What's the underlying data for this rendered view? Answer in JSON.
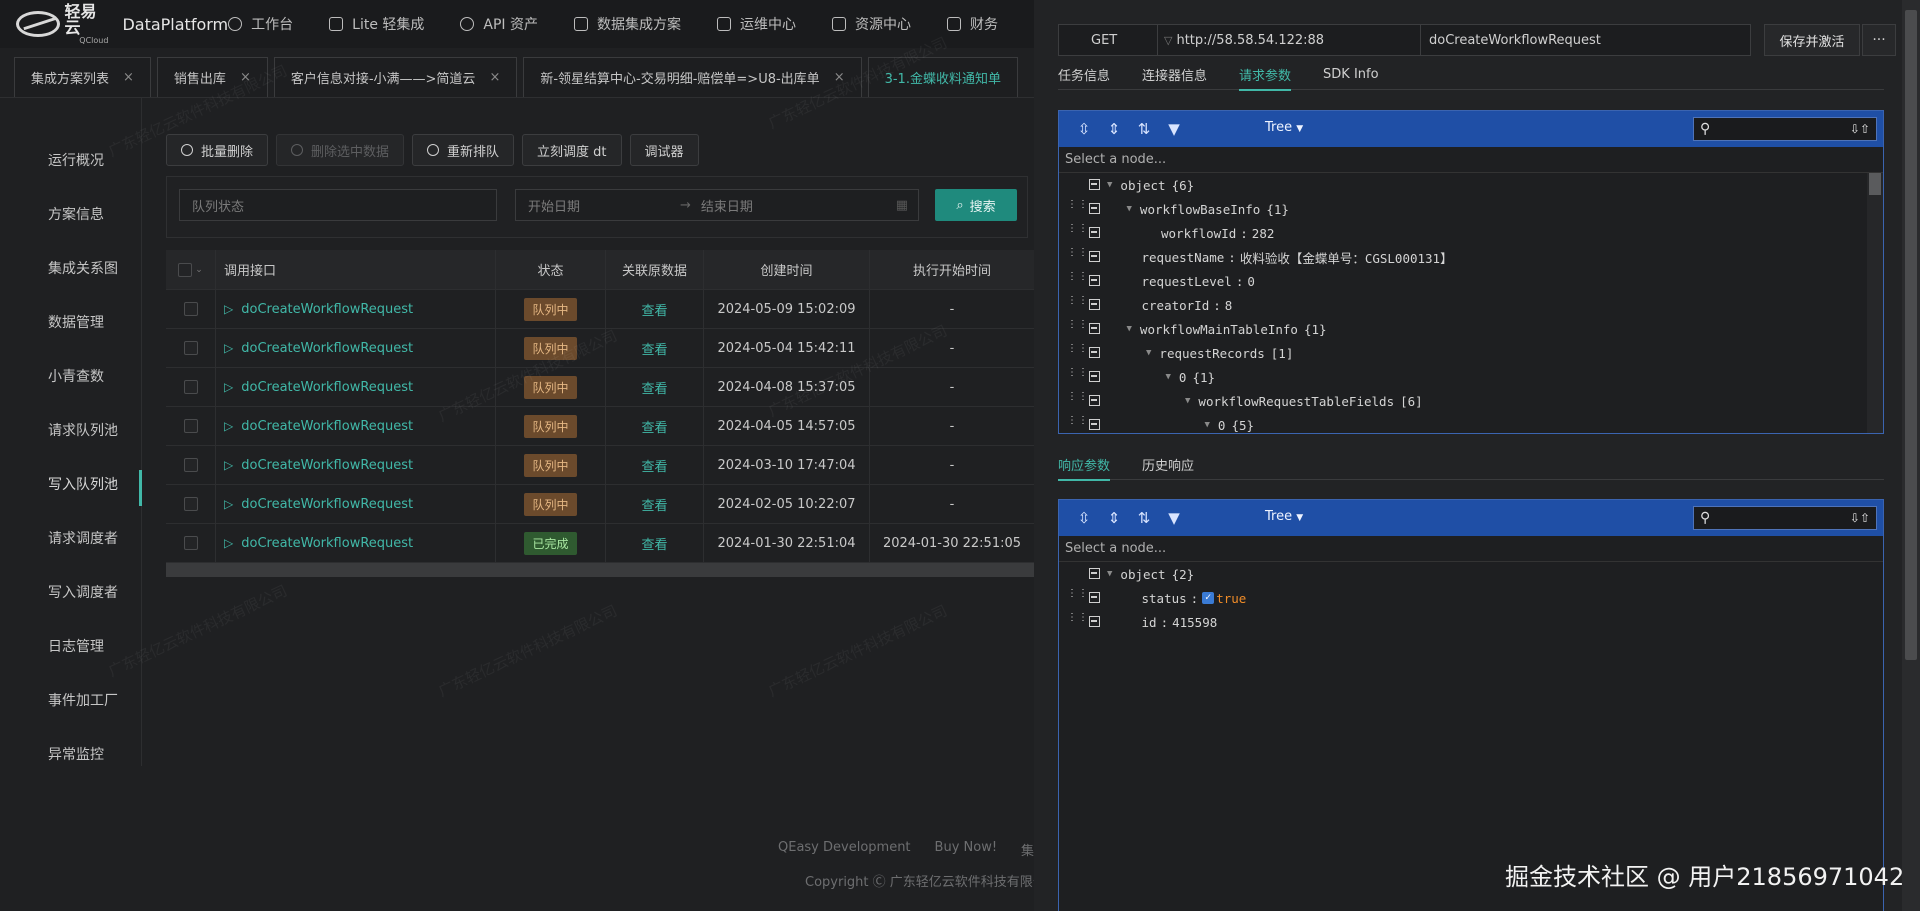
{
  "app": {
    "logo_cn": "轻易云",
    "logo_sub": "QCloud",
    "name": "DataPlatform"
  },
  "nav": [
    {
      "label": "工作台",
      "icon": "clock-icon"
    },
    {
      "label": "Lite 轻集成",
      "icon": "bell-icon"
    },
    {
      "label": "API 资产",
      "icon": "compass-icon"
    },
    {
      "label": "数据集成方案",
      "icon": "flow-icon"
    },
    {
      "label": "运维中心",
      "icon": "flag-icon"
    },
    {
      "label": "资源中心",
      "icon": "resource-icon"
    },
    {
      "label": "财务",
      "icon": "finance-icon"
    }
  ],
  "tabs": [
    {
      "label": "集成方案列表",
      "active": false
    },
    {
      "label": "销售出库",
      "active": false
    },
    {
      "label": "客户信息对接-小满——>简道云",
      "active": false
    },
    {
      "label": "新-领星结算中心-交易明细-赔偿单=>U8-出库单",
      "active": false
    },
    {
      "label": "3-1.金蝶收料通知单",
      "active": true
    }
  ],
  "left_menu": [
    "运行概况",
    "方案信息",
    "集成关系图",
    "数据管理",
    "小青查数",
    "请求队列池",
    "写入队列池",
    "请求调度者",
    "写入调度者",
    "日志管理",
    "事件加工厂",
    "异常监控"
  ],
  "left_menu_active": "写入队列池",
  "toolbar": {
    "batch_delete": "批量删除",
    "delete_selected": "删除选中数据",
    "requeue": "重新排队",
    "dispatch_now": "立刻调度 dt",
    "debugger": "调试器"
  },
  "filter": {
    "queue_status_placeholder": "队列状态",
    "start_date_placeholder": "开始日期",
    "date_sep": "→",
    "end_date_placeholder": "结束日期",
    "search_label": "搜索"
  },
  "table": {
    "headers": [
      "",
      "调用接口",
      "状态",
      "关联原数据",
      "创建时间",
      "执行开始时间"
    ],
    "rows": [
      {
        "api": "doCreateWorkflowRequest",
        "status": "队列中",
        "status_type": "queue",
        "link": "查看",
        "created": "2024-05-09 15:02:09",
        "exec_start": "-"
      },
      {
        "api": "doCreateWorkflowRequest",
        "status": "队列中",
        "status_type": "queue",
        "link": "查看",
        "created": "2024-05-04 15:42:11",
        "exec_start": "-"
      },
      {
        "api": "doCreateWorkflowRequest",
        "status": "队列中",
        "status_type": "queue",
        "link": "查看",
        "created": "2024-04-08 15:37:05",
        "exec_start": "-"
      },
      {
        "api": "doCreateWorkflowRequest",
        "status": "队列中",
        "status_type": "queue",
        "link": "查看",
        "created": "2024-04-05 14:57:05",
        "exec_start": "-"
      },
      {
        "api": "doCreateWorkflowRequest",
        "status": "队列中",
        "status_type": "queue",
        "link": "查看",
        "created": "2024-03-10 17:47:04",
        "exec_start": "-"
      },
      {
        "api": "doCreateWorkflowRequest",
        "status": "队列中",
        "status_type": "queue",
        "link": "查看",
        "created": "2024-02-05 10:22:07",
        "exec_start": "-"
      },
      {
        "api": "doCreateWorkflowRequest",
        "status": "已完成",
        "status_type": "done",
        "link": "查看",
        "created": "2024-01-30 22:51:04",
        "exec_start": "2024-01-30 22:51:05"
      }
    ]
  },
  "footer": {
    "links": [
      "QEasy Development",
      "Buy Now!",
      "集成"
    ],
    "copyright": "Copyright Ⓒ 广东轻亿云软件科技有限公司"
  },
  "watermark_text": "广东轻亿云软件科技有限公司",
  "panel": {
    "method": "GET",
    "url": "http://58.58.54.122:88",
    "api_name": "doCreateWorkflowRequest",
    "save_label": "保存并激活",
    "more_label": "···",
    "req_tabs": [
      {
        "label": "任务信息",
        "active": false
      },
      {
        "label": "连接器信息",
        "active": false
      },
      {
        "label": "请求参数",
        "active": true
      },
      {
        "label": "SDK Info",
        "active": false
      }
    ],
    "resp_tabs": [
      {
        "label": "响应参数",
        "active": true
      },
      {
        "label": "历史响应",
        "active": false
      }
    ],
    "editor_mode": "Tree",
    "node_placeholder": "Select a node...",
    "request_tree": [
      {
        "level": 0,
        "expand": true,
        "key": "object",
        "count": "{6}",
        "drag": false
      },
      {
        "level": 1,
        "expand": true,
        "key": "workflowBaseInfo",
        "count": "{1}",
        "drag": true
      },
      {
        "level": 2,
        "expand": false,
        "key": "workflowId",
        "value": "282",
        "drag": true
      },
      {
        "level": 1,
        "expand": false,
        "key": "requestName",
        "value": "收料验收【金蝶单号：CGSL000131】",
        "drag": true
      },
      {
        "level": 1,
        "expand": false,
        "key": "requestLevel",
        "value": "0",
        "drag": true
      },
      {
        "level": 1,
        "expand": false,
        "key": "creatorId",
        "value": "8",
        "drag": true
      },
      {
        "level": 1,
        "expand": true,
        "key": "workflowMainTableInfo",
        "count": "{1}",
        "drag": true
      },
      {
        "level": 2,
        "expand": true,
        "key": "requestRecords",
        "count": "[1]",
        "drag": true
      },
      {
        "level": 3,
        "expand": true,
        "key": "0",
        "count": "{1}",
        "drag": true
      },
      {
        "level": 4,
        "expand": true,
        "key": "workflowRequestTableFields",
        "count": "[6]",
        "drag": true
      },
      {
        "level": 5,
        "expand": true,
        "key": "0",
        "count": "{5}",
        "drag": true
      }
    ],
    "response_tree": [
      {
        "level": 0,
        "expand": true,
        "key": "object",
        "count": "{2}",
        "drag": false
      },
      {
        "level": 1,
        "expand": false,
        "key": "status",
        "value": "true",
        "bool": true,
        "drag": true
      },
      {
        "level": 1,
        "expand": false,
        "key": "id",
        "value": "415598",
        "drag": true
      }
    ]
  },
  "credit": "掘金技术社区 @ 用户21856971042"
}
